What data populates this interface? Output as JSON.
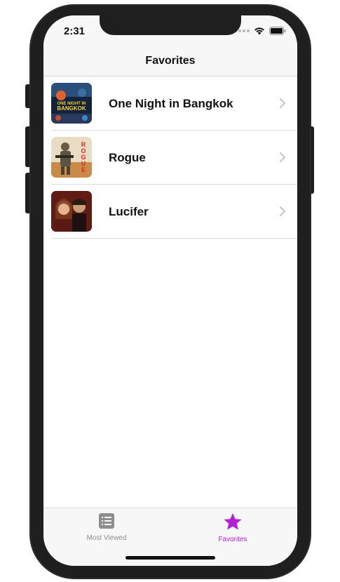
{
  "status_bar": {
    "time": "2:31"
  },
  "nav": {
    "title": "Favorites"
  },
  "favorites": [
    {
      "title": "One Night in Bangkok",
      "poster_icon": "movie-poster-one-night-in-bangkok"
    },
    {
      "title": "Rogue",
      "poster_icon": "movie-poster-rogue"
    },
    {
      "title": "Lucifer",
      "poster_icon": "movie-poster-lucifer"
    }
  ],
  "tabs": [
    {
      "label": "Most Viewed",
      "icon": "list-icon",
      "selected": false
    },
    {
      "label": "Favorites",
      "icon": "star-icon",
      "selected": true
    }
  ],
  "colors": {
    "accent": "#b51fd3",
    "inactive": "#8e8e8e",
    "bar_background": "#f7f7f7"
  }
}
